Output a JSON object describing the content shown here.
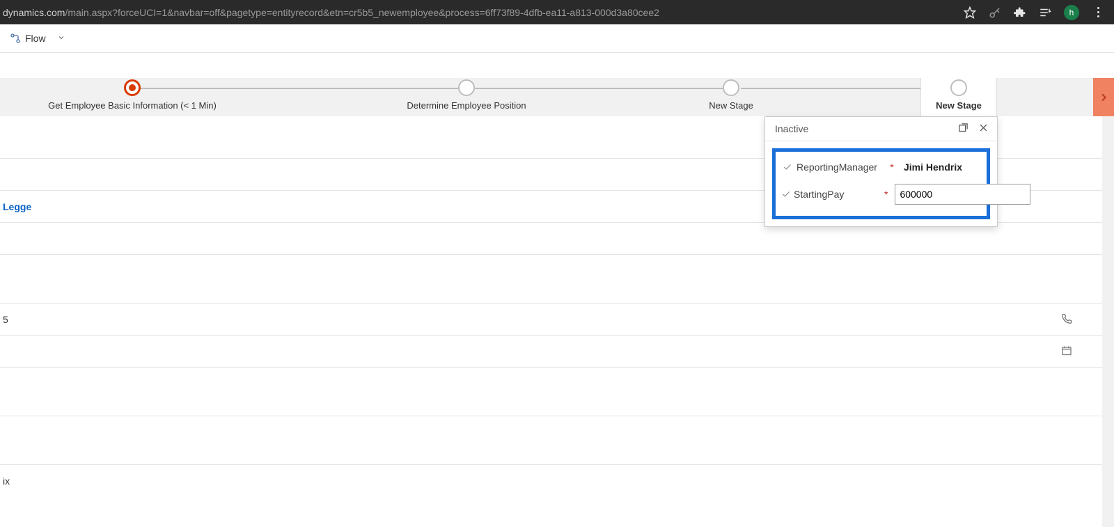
{
  "browser": {
    "url_host": "dynamics.com",
    "url_path": "/main.aspx?forceUCI=1&navbar=off&pagetype=entityrecord&etn=cr5b5_newemployee&process=6ff73f89-4dfb-ea11-a813-000d3a80cee2",
    "profile_letter": "h"
  },
  "command_bar": {
    "flow_label": "Flow"
  },
  "process": {
    "stages": [
      {
        "label": "Get Employee Basic Information  (< 1 Min)",
        "active": true,
        "bold": false
      },
      {
        "label": "Determine Employee Position",
        "active": false,
        "bold": false
      },
      {
        "label": "New Stage",
        "active": false,
        "bold": false
      },
      {
        "label": "New Stage",
        "active": false,
        "bold": true
      }
    ]
  },
  "flyout": {
    "status": "Inactive",
    "fields": {
      "reporting_manager": {
        "label": "ReportingManager",
        "value": "Jimi Hendrix"
      },
      "starting_pay": {
        "label": "StartingPay",
        "value": "600000"
      }
    }
  },
  "form": {
    "link_fragment": "Legge",
    "num_fragment": "5",
    "trailing_fragment": "ix"
  }
}
